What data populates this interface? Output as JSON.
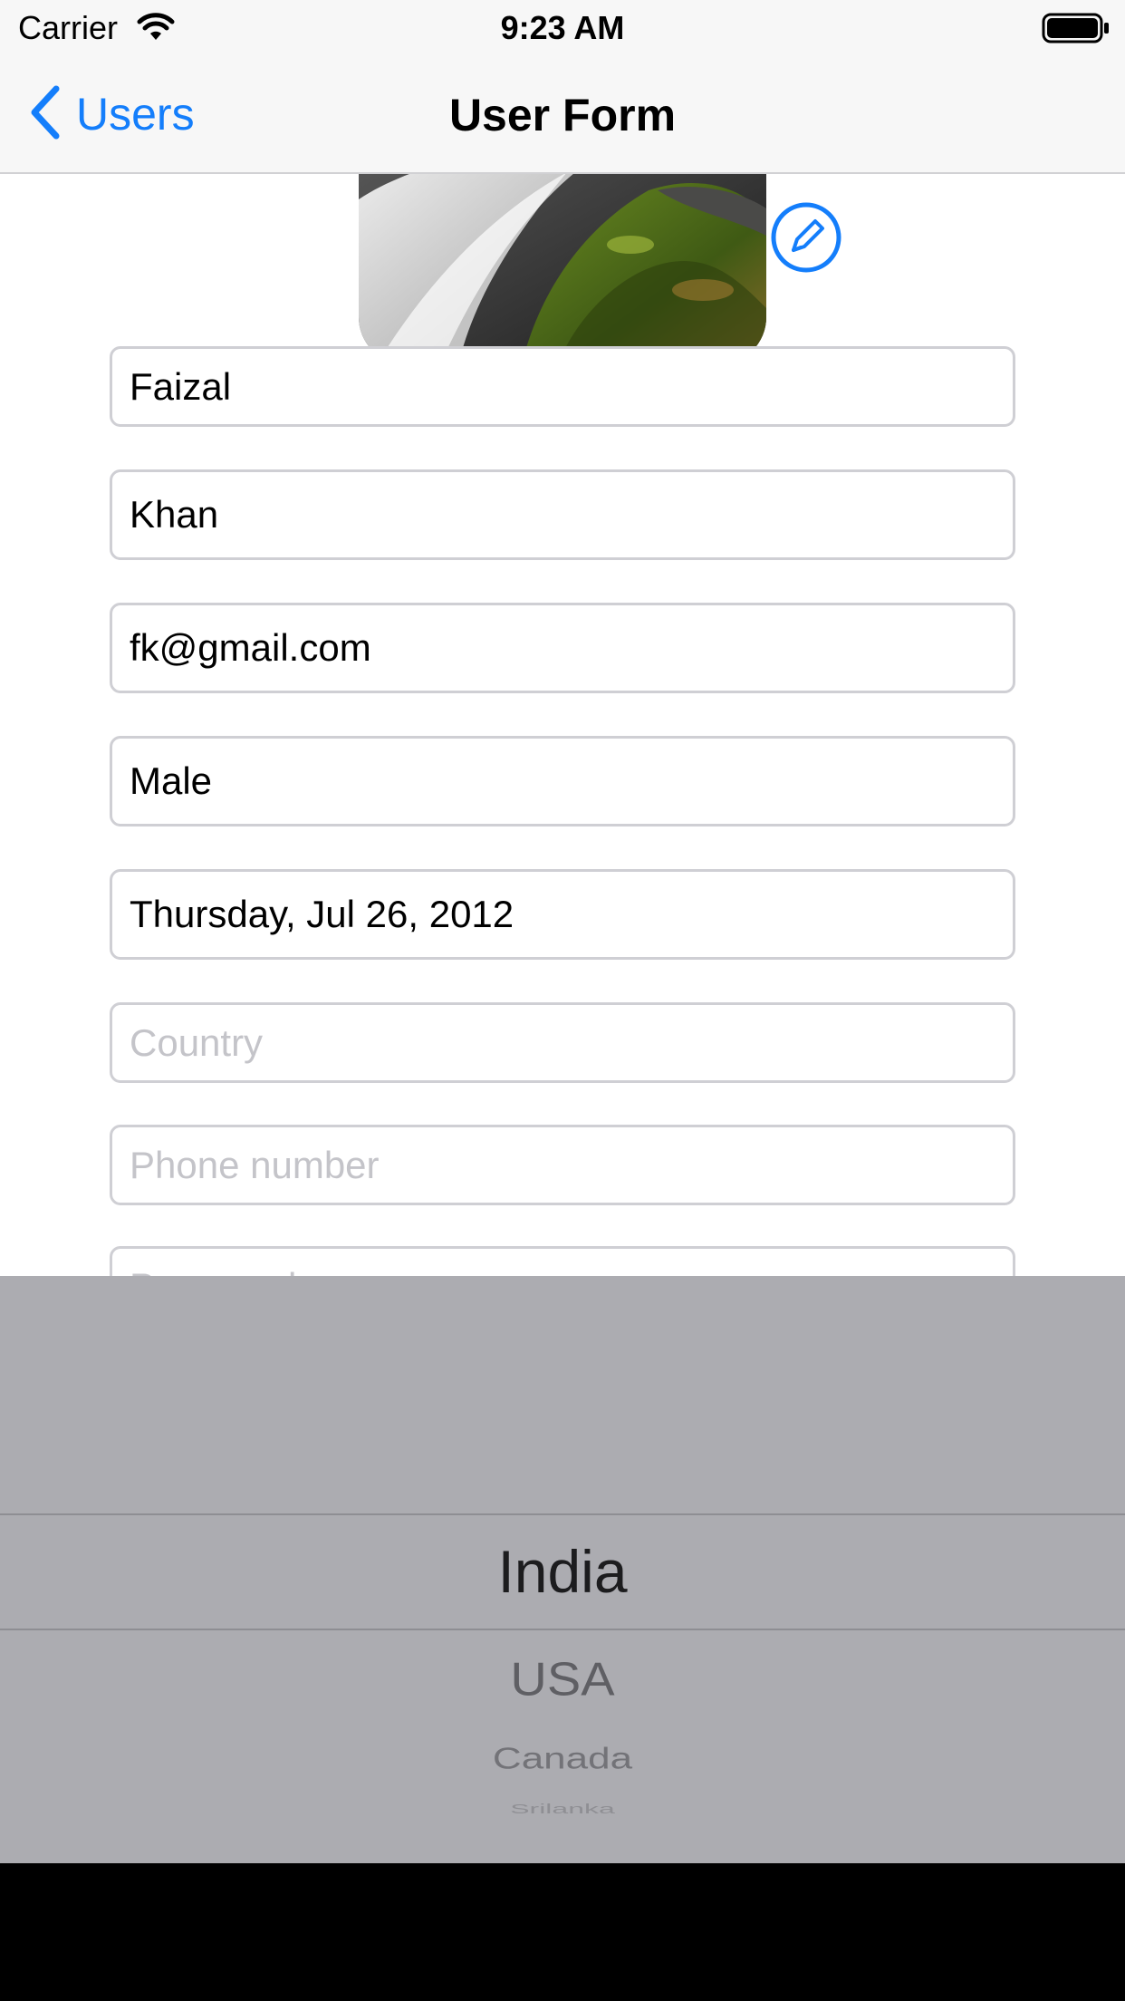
{
  "status_bar": {
    "carrier": "Carrier",
    "time": "9:23 AM"
  },
  "nav": {
    "back_label": "Users",
    "title": "User Form"
  },
  "form": {
    "first_name": "Faizal",
    "last_name": "Khan",
    "email": "fk@gmail.com",
    "gender": "Male",
    "birth_date": "Thursday, Jul 26, 2012",
    "country_placeholder": "Country",
    "phone_placeholder": "Phone number",
    "password_placeholder": "Password"
  },
  "picker": {
    "selected": "India",
    "options_below": [
      "USA",
      "Canada",
      "Srilanka"
    ]
  },
  "colors": {
    "accent": "#147efb",
    "picker_background": "#acacb1",
    "field_border": "#cfcfd4",
    "placeholder": "#c4c4c9"
  },
  "icons": {
    "back": "chevron-left-icon",
    "edit": "pencil-circle-icon",
    "wifi": "wifi-icon",
    "battery": "battery-icon"
  }
}
